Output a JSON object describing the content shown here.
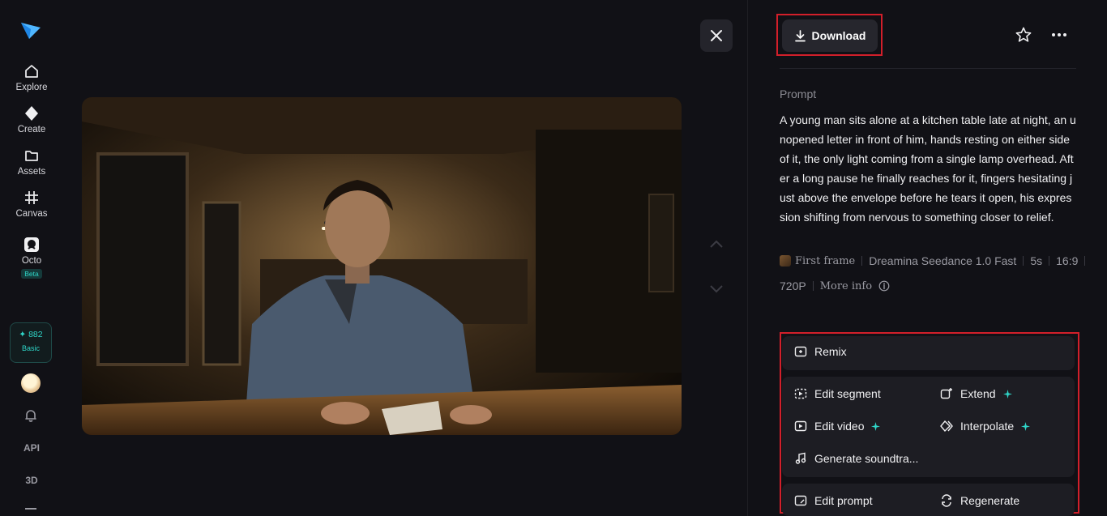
{
  "sidebar": {
    "logo": "logo-icon",
    "items": [
      {
        "label": "Explore",
        "icon": "home-icon"
      },
      {
        "label": "Create",
        "icon": "diamond-icon"
      },
      {
        "label": "Assets",
        "icon": "folder-icon"
      },
      {
        "label": "Canvas",
        "icon": "grid-icon"
      },
      {
        "label": "Octo",
        "icon": "octo-icon",
        "badge": "Beta"
      }
    ],
    "credits": {
      "count": "✦ 882",
      "tier": "Basic"
    },
    "api_label": "API",
    "three_d_label": "3D"
  },
  "toolbar": {
    "download_label": "Download",
    "favorite_icon": "star-icon",
    "more_icon": "more-icon",
    "close_icon": "close-icon"
  },
  "prompt": {
    "label": "Prompt",
    "text": "A young man sits alone at a kitchen table late at night, an unopened letter in front of him, hands resting on either side of it, the only light coming from a single lamp overhead. After a long pause he finally reaches for it, fingers hesitating just above the envelope before he tears it open, his expression shifting from nervous to something closer to relief."
  },
  "meta": {
    "first_frame": "First frame",
    "model": "Dreamina Seedance 1.0 Fast",
    "duration": "5s",
    "ratio": "16:9",
    "resolution": "720P",
    "more_info": "More info"
  },
  "actions": {
    "remix": "Remix",
    "edit_segment": "Edit segment",
    "extend": "Extend",
    "edit_video": "Edit video",
    "interpolate": "Interpolate",
    "generate_soundtrack": "Generate soundtra...",
    "edit_prompt": "Edit prompt",
    "regenerate": "Regenerate"
  },
  "colors": {
    "accent": "#2fd6c8",
    "highlight": "#d21f2a",
    "background": "#111116"
  }
}
